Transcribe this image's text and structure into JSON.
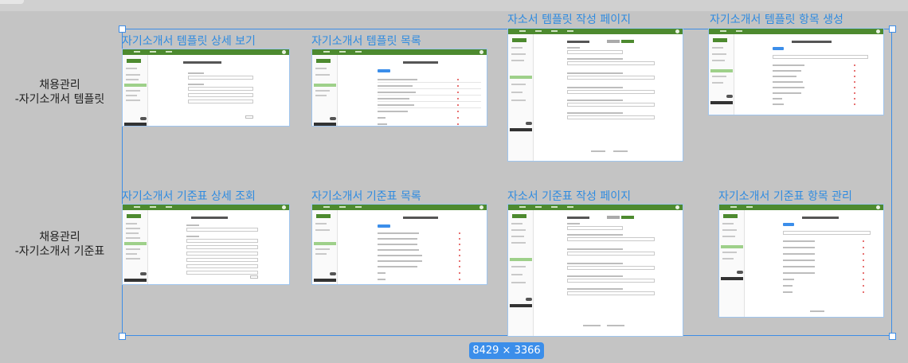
{
  "row_labels": [
    {
      "line1": "채용관리",
      "line2": "-자기소개서 템플릿"
    },
    {
      "line1": "채용관리",
      "line2": "-자기소개서 기준표"
    }
  ],
  "frames": [
    {
      "title": "자기소개서 템플릿 상세 보기"
    },
    {
      "title": "자기소개서 템플릿 목록"
    },
    {
      "title": "자소서 템플릿 작성 페이지"
    },
    {
      "title": "자기소개서 템플릿 항목 생성"
    },
    {
      "title": "자기소개서 기준표 상세 조회"
    },
    {
      "title": "자기소개서 기준표 목록"
    },
    {
      "title": "자소서 기준표 작성 페이지"
    },
    {
      "title": "자기소개서 기준표 항목 관리"
    }
  ],
  "selection": {
    "dimensions": "8429 × 3366"
  },
  "colors": {
    "accent": "#3b8eea",
    "brand_green": "#4d8a2f",
    "canvas": "#c4c4c4"
  }
}
